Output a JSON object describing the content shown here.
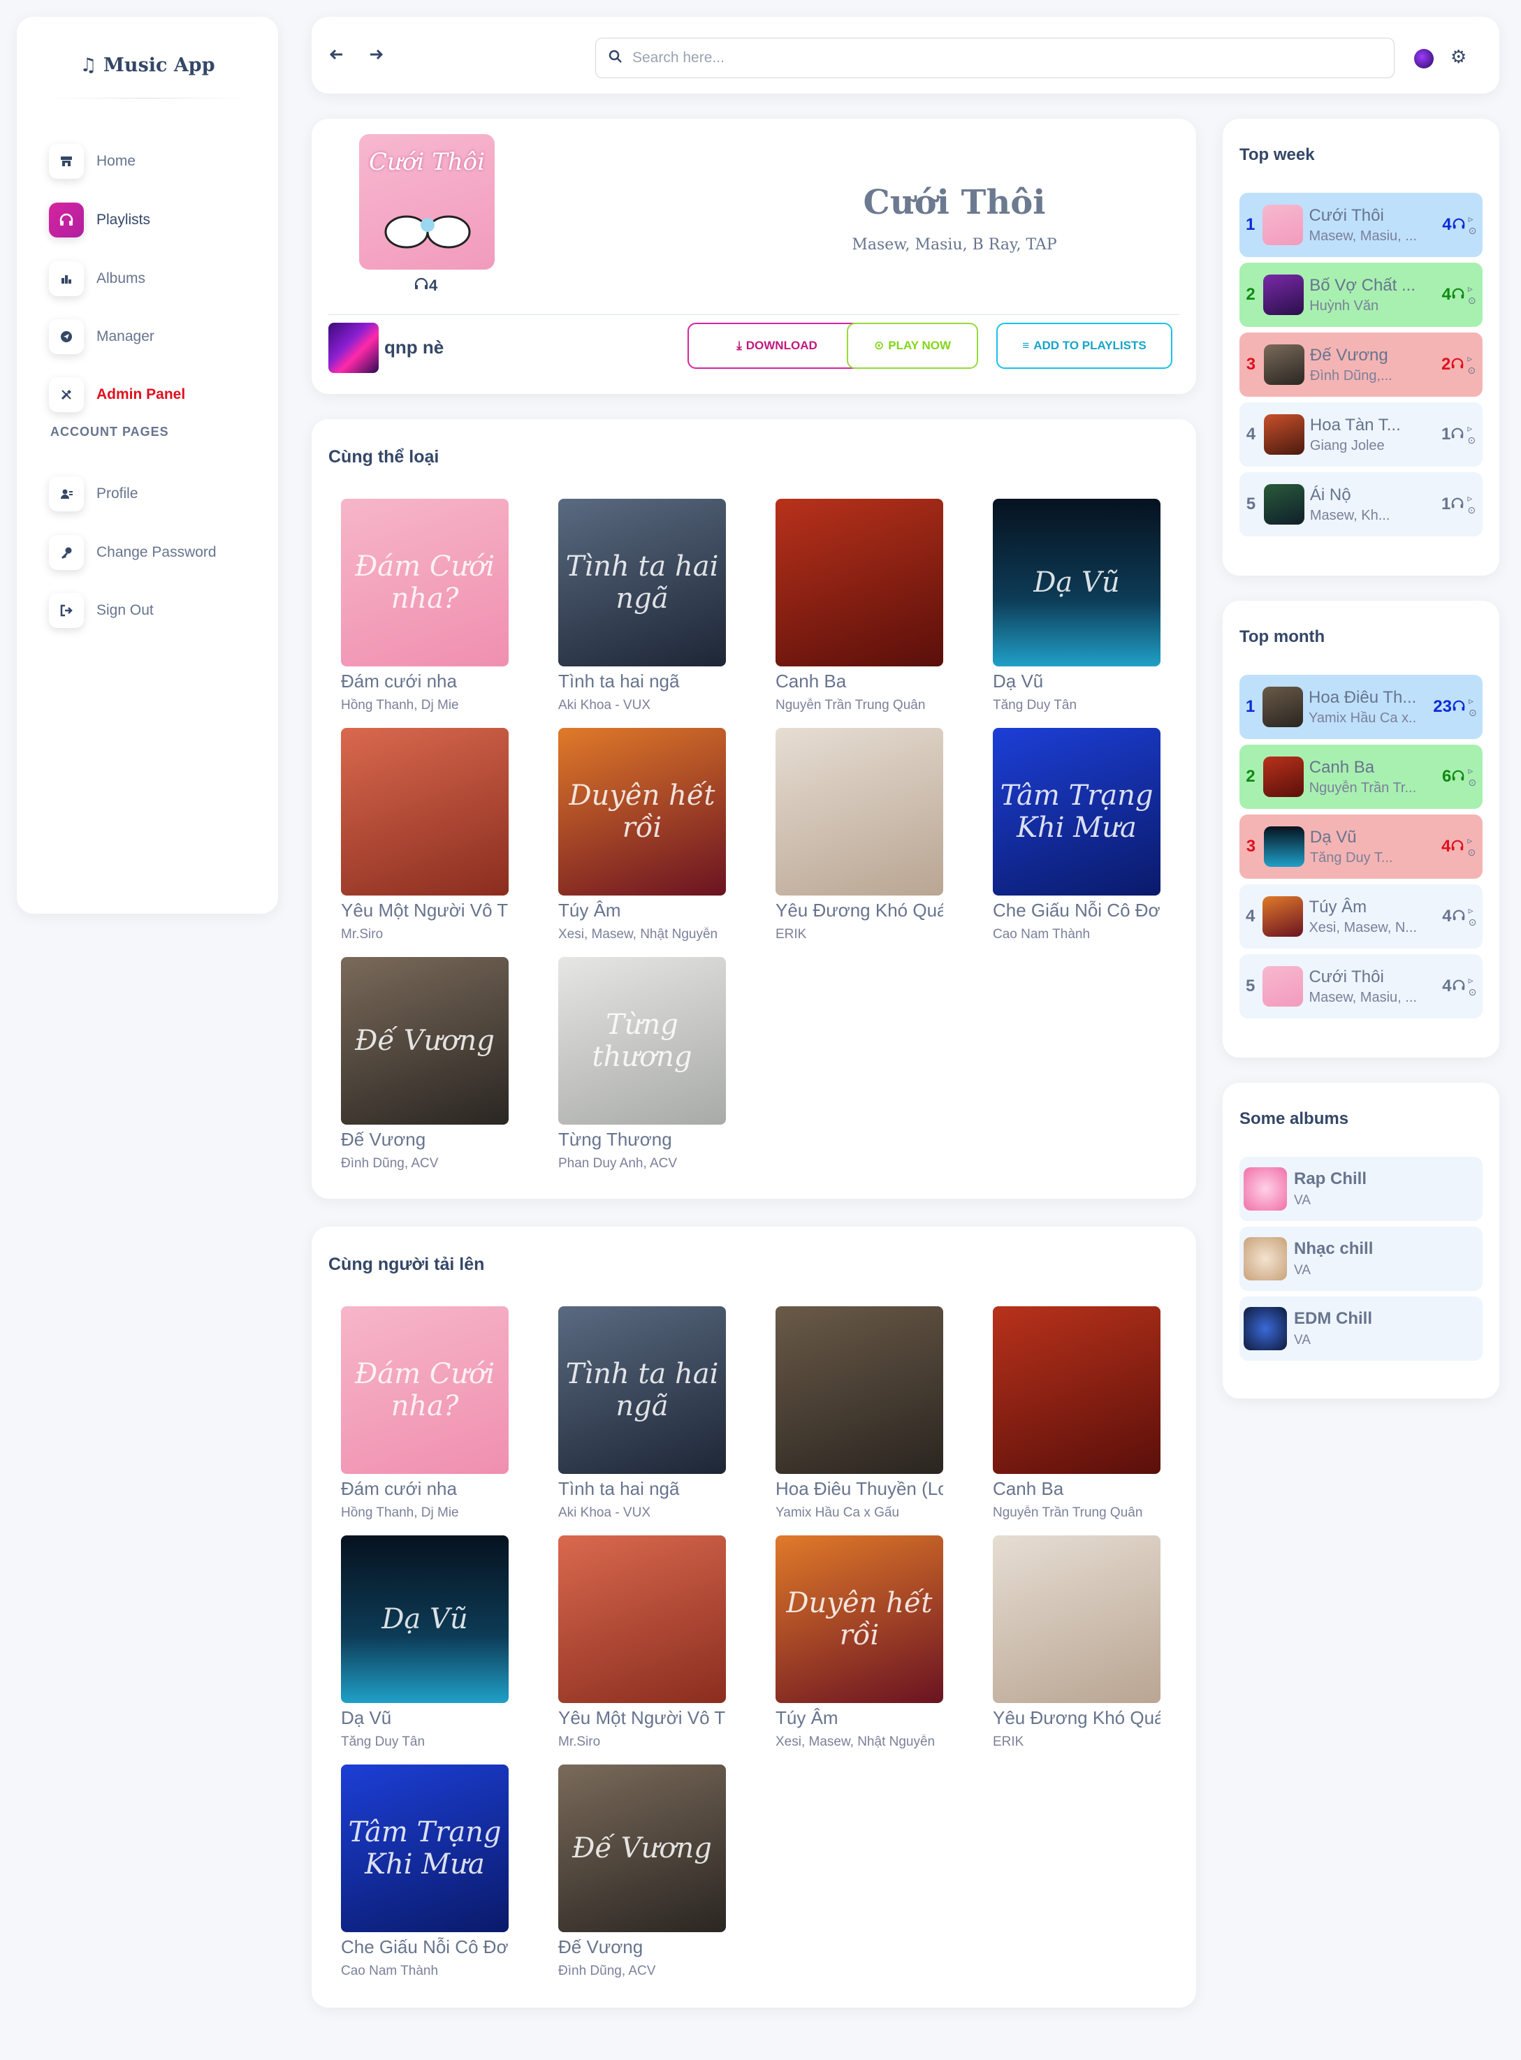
{
  "app": {
    "brand": "Music App"
  },
  "sidebar": {
    "items": [
      {
        "label": "Home",
        "icon": "store-icon"
      },
      {
        "label": "Playlists",
        "icon": "headphones-icon"
      },
      {
        "label": "Albums",
        "icon": "chart-icon"
      },
      {
        "label": "Manager",
        "icon": "send-icon"
      },
      {
        "label": "Admin Panel",
        "icon": "tools-icon"
      }
    ],
    "section_title": "ACCOUNT PAGES",
    "account_items": [
      {
        "label": "Profile",
        "icon": "user-icon"
      },
      {
        "label": "Change Password",
        "icon": "key-icon"
      },
      {
        "label": "Sign Out",
        "icon": "sign-out-icon"
      }
    ]
  },
  "topbar": {
    "search_placeholder": "Search here..."
  },
  "song": {
    "title": "Cưới Thôi",
    "artists": "Masew, Masiu, B Ray, TAP",
    "listens": "4",
    "uploader": "qnp nè",
    "download_label": "DOWNLOAD",
    "play_label": "PLAY NOW",
    "add_label": "ADD TO PLAYLISTS"
  },
  "same_genre": {
    "title": "Cùng thể loại",
    "items": [
      {
        "name": "Đám cưới nha",
        "artist": "Hồng Thanh, Dj Mie"
      },
      {
        "name": "Tình ta hai ngã",
        "artist": "Aki Khoa - VUX"
      },
      {
        "name": "Canh Ba",
        "artist": "Nguyễn Trần Trung Quân"
      },
      {
        "name": "Dạ Vũ",
        "artist": "Tăng Duy Tân"
      },
      {
        "name": "Yêu Một Người Vô Tâm",
        "artist": "Mr.Siro"
      },
      {
        "name": "Túy Âm",
        "artist": "Xesi, Masew, Nhật Nguyễn"
      },
      {
        "name": "Yêu Đương Khó Quá",
        "artist": "ERIK"
      },
      {
        "name": "Che Giấu Nỗi Cô Đơn",
        "artist": "Cao Nam Thành"
      },
      {
        "name": "Đế Vương",
        "artist": "Đình Dũng, ACV"
      },
      {
        "name": "Từng Thương",
        "artist": "Phan Duy Anh, ACV"
      }
    ]
  },
  "same_uploader": {
    "title": "Cùng người tải lên",
    "items": [
      {
        "name": "Đám cưới nha",
        "artist": "Hồng Thanh, Dj Mie"
      },
      {
        "name": "Tình ta hai ngã",
        "artist": "Aki Khoa - VUX"
      },
      {
        "name": "Hoa Điêu Thuyền (Lofi)",
        "artist": "Yamix Hầu Ca x Gấu"
      },
      {
        "name": "Canh Ba",
        "artist": "Nguyễn Trần Trung Quân"
      },
      {
        "name": "Dạ Vũ",
        "artist": "Tăng Duy Tân"
      },
      {
        "name": "Yêu Một Người Vô Tâm",
        "artist": "Mr.Siro"
      },
      {
        "name": "Túy Âm",
        "artist": "Xesi, Masew, Nhật Nguyễn"
      },
      {
        "name": "Yêu Đương Khó Quá",
        "artist": "ERIK"
      },
      {
        "name": "Che Giấu Nỗi Cô Đơn",
        "artist": "Cao Nam Thành"
      },
      {
        "name": "Đế Vương",
        "artist": "Đình Dũng, ACV"
      }
    ]
  },
  "top_week": {
    "title": "Top week",
    "items": [
      {
        "rank": "1",
        "song": "Cưới Thôi",
        "artist": "Masew, Masiu, ...",
        "count": "4"
      },
      {
        "rank": "2",
        "song": "Bố Vợ Chất ...",
        "artist": "Huỳnh Văn",
        "count": "4"
      },
      {
        "rank": "3",
        "song": "Đế Vương",
        "artist": "Đình Dũng,...",
        "count": "2"
      },
      {
        "rank": "4",
        "song": "Hoa Tàn T...",
        "artist": "Giang Jolee",
        "count": "1"
      },
      {
        "rank": "5",
        "song": "Ái Nộ",
        "artist": "Masew, Kh...",
        "count": "1"
      }
    ]
  },
  "top_month": {
    "title": "Top month",
    "items": [
      {
        "rank": "1",
        "song": "Hoa Điêu Th...",
        "artist": "Yamix Hầu Ca x...",
        "count": "23"
      },
      {
        "rank": "2",
        "song": "Canh Ba",
        "artist": "Nguyễn Trần Tr...",
        "count": "6"
      },
      {
        "rank": "3",
        "song": "Dạ Vũ",
        "artist": "Tăng Duy T...",
        "count": "4"
      },
      {
        "rank": "4",
        "song": "Túy Âm",
        "artist": "Xesi, Masew, N...",
        "count": "4"
      },
      {
        "rank": "5",
        "song": "Cưới Thôi",
        "artist": "Masew, Masiu, ...",
        "count": "4"
      }
    ]
  },
  "albums": {
    "title": "Some albums",
    "items": [
      {
        "name": "Rap Chill",
        "artist": "VA"
      },
      {
        "name": "Nhạc chill",
        "artist": "VA"
      },
      {
        "name": "EDM Chill",
        "artist": "VA"
      }
    ]
  },
  "colors": {
    "accent": "#d6249f",
    "rank1": "#0b2bd8",
    "rank2": "#0f8a12",
    "rank3": "#e0101e"
  }
}
